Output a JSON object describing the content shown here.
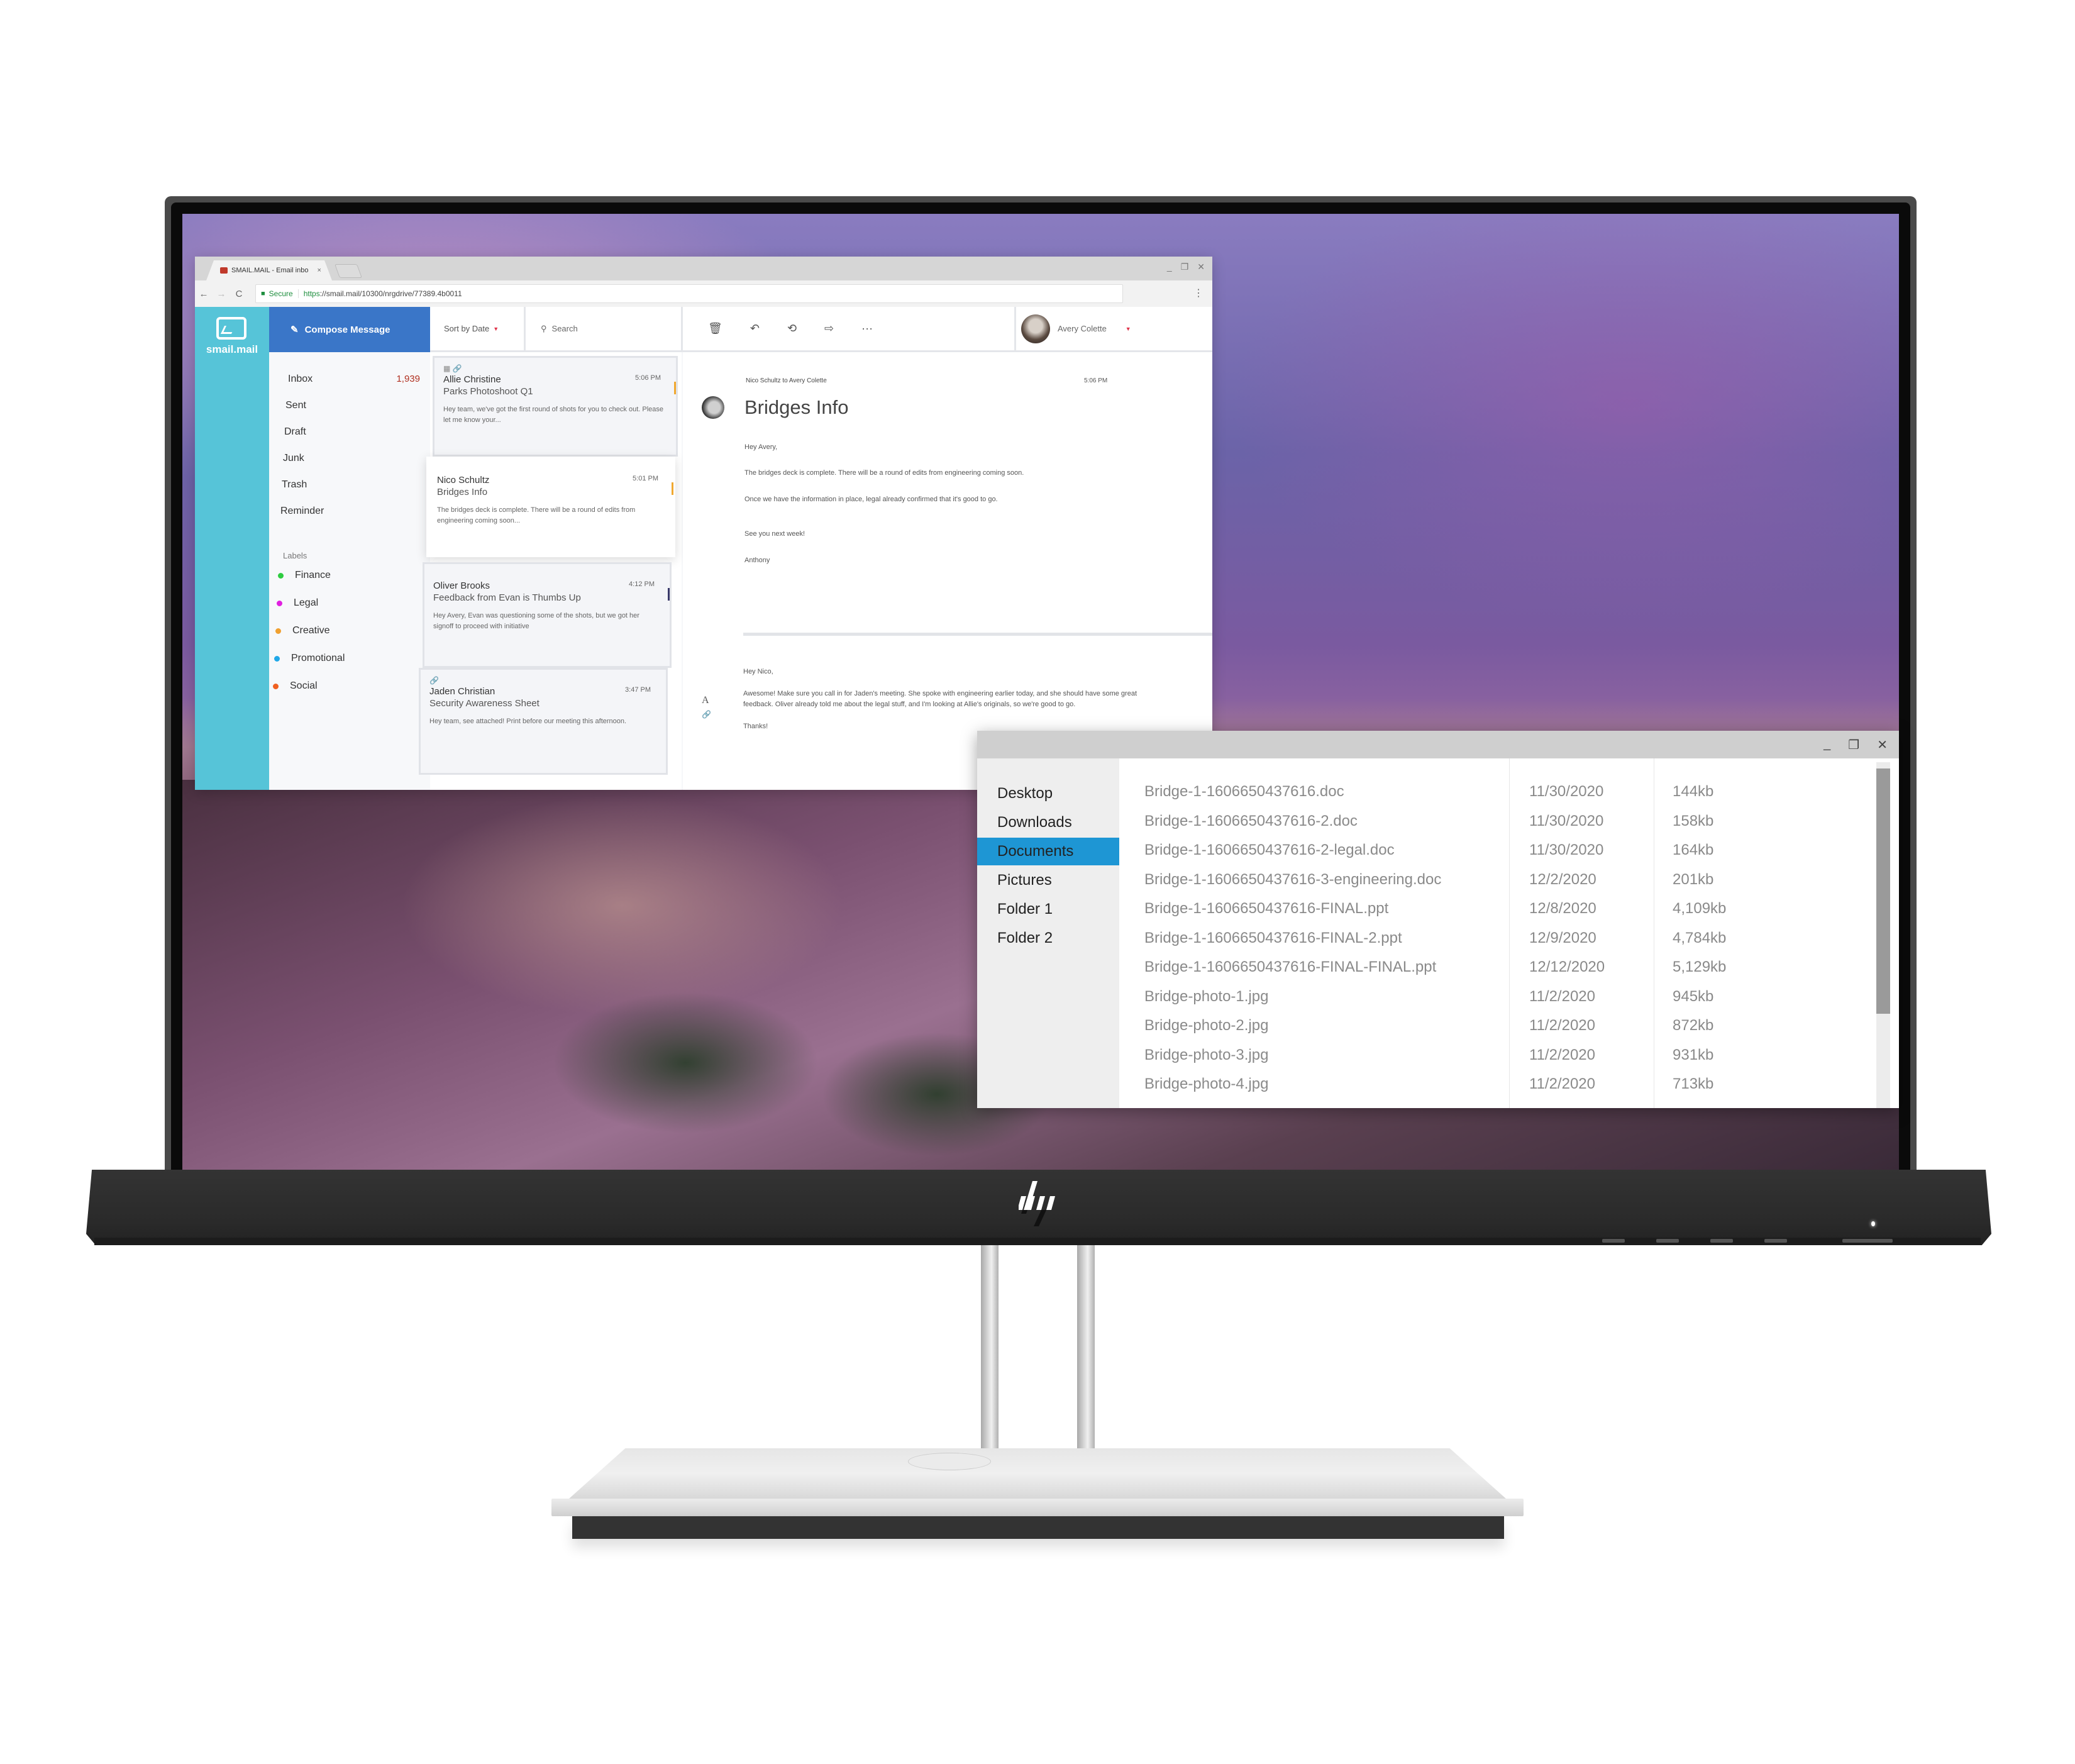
{
  "browser": {
    "tab_title": "SMAIL.MAIL - Email inbo",
    "tab_close": "×",
    "window_controls": [
      "_",
      "❐",
      "✕"
    ],
    "nav": {
      "back": "←",
      "forward": "→",
      "reload": "C"
    },
    "address": {
      "secure_label": "Secure",
      "url_scheme": "https",
      "url_rest": "://smail.mail/10300/nrgdrive/77389.4b0011"
    },
    "menu_icon": "⋮"
  },
  "mail": {
    "brand": "smail.mail",
    "compose_label": "Compose Message",
    "sort_label": "Sort by Date",
    "search_placeholder": "Search",
    "toolbar_icons": [
      "trash-icon",
      "reply-icon",
      "reply-all-icon",
      "forward-icon",
      "more-icon"
    ],
    "user_name": "Avery Colette",
    "folders": [
      {
        "name": "Inbox",
        "count": "1,939"
      },
      {
        "name": "Sent",
        "count": ""
      },
      {
        "name": "Draft",
        "count": ""
      },
      {
        "name": "Junk",
        "count": ""
      },
      {
        "name": "Trash",
        "count": ""
      },
      {
        "name": "Reminder",
        "count": ""
      }
    ],
    "labels_title": "Labels",
    "labels": [
      {
        "name": "Finance",
        "color": "#2ecc40"
      },
      {
        "name": "Legal",
        "color": "#e020e0"
      },
      {
        "name": "Creative",
        "color": "#f0a030"
      },
      {
        "name": "Promotional",
        "color": "#20a8e8"
      },
      {
        "name": "Social",
        "color": "#f06020"
      }
    ],
    "messages": [
      {
        "sender": "Allie Christine",
        "time": "5:06 PM",
        "subject": "Parks Photoshoot Q1",
        "preview": "Hey team, we've got the first round of shots for you to check out. Please let me know your...",
        "icons": "▦ 🔗",
        "flag_color": "#f0a830"
      },
      {
        "sender": "Nico Schultz",
        "time": "5:01 PM",
        "subject": "Bridges Info",
        "preview": "The bridges deck is complete. There will be a round of edits from engineering coming soon...",
        "icons": "",
        "flag_color": "#f0a830"
      },
      {
        "sender": "Oliver Brooks",
        "time": "4:12 PM",
        "subject": "Feedback from Evan is Thumbs Up",
        "preview": "Hey Avery, Evan was questioning some of the shots, but we got her signoff to proceed with initiative",
        "icons": "",
        "flag_color": "#3a3a6a"
      },
      {
        "sender": "Jaden Christian",
        "time": "3:47 PM",
        "subject": "Security Awareness Sheet",
        "preview": "Hey team, see attached! Print before our meeting this afternoon.",
        "icons": "🔗",
        "flag_color": ""
      }
    ],
    "reader": {
      "meta": "Nico Schultz to Avery Colette",
      "time": "5:06 PM",
      "title": "Bridges Info",
      "body": [
        "Hey Avery,",
        "The bridges deck is complete. There will be a round of edits from engineering coming soon.",
        "Once we have the information in place, legal already confirmed that it's good to go.",
        "See you next week!",
        "Anthony"
      ],
      "reply": [
        "Hey Nico,",
        "Awesome! Make sure you call in for Jaden's meeting. She spoke with engineering earlier today, and she should have some great feedback. Oliver already told me about the legal stuff, and I'm looking at Allie's originals, so we're good to go.",
        "Thanks!"
      ],
      "reply_tools": [
        "A",
        "🔗"
      ]
    }
  },
  "explorer": {
    "window_controls": [
      "_",
      "❐",
      "✕"
    ],
    "nav": [
      {
        "name": "Desktop",
        "active": false
      },
      {
        "name": "Downloads",
        "active": false
      },
      {
        "name": "Documents",
        "active": true
      },
      {
        "name": "Pictures",
        "active": false
      },
      {
        "name": "Folder 1",
        "active": false
      },
      {
        "name": "Folder 2",
        "active": false
      }
    ],
    "files": [
      {
        "name": "Bridge-1-1606650437616.doc",
        "date": "11/30/2020",
        "size": "144kb"
      },
      {
        "name": "Bridge-1-1606650437616-2.doc",
        "date": "11/30/2020",
        "size": "158kb"
      },
      {
        "name": "Bridge-1-1606650437616-2-legal.doc",
        "date": "11/30/2020",
        "size": "164kb"
      },
      {
        "name": "Bridge-1-1606650437616-3-engineering.doc",
        "date": "12/2/2020",
        "size": "201kb"
      },
      {
        "name": "Bridge-1-1606650437616-FINAL.ppt",
        "date": "12/8/2020",
        "size": "4,109kb"
      },
      {
        "name": "Bridge-1-1606650437616-FINAL-2.ppt",
        "date": "12/9/2020",
        "size": "4,784kb"
      },
      {
        "name": "Bridge-1-1606650437616-FINAL-FINAL.ppt",
        "date": "12/12/2020",
        "size": "5,129kb"
      },
      {
        "name": "Bridge-photo-1.jpg",
        "date": "11/2/2020",
        "size": "945kb"
      },
      {
        "name": "Bridge-photo-2.jpg",
        "date": "11/2/2020",
        "size": "872kb"
      },
      {
        "name": "Bridge-photo-3.jpg",
        "date": "11/2/2020",
        "size": "931kb"
      },
      {
        "name": "Bridge-photo-4.jpg",
        "date": "11/2/2020",
        "size": "713kb"
      }
    ]
  },
  "colors": {
    "brand_teal": "#56c4d8",
    "compose_blue": "#3a76c8",
    "explorer_selected": "#1e96d4",
    "inbox_count": "#b03020"
  }
}
